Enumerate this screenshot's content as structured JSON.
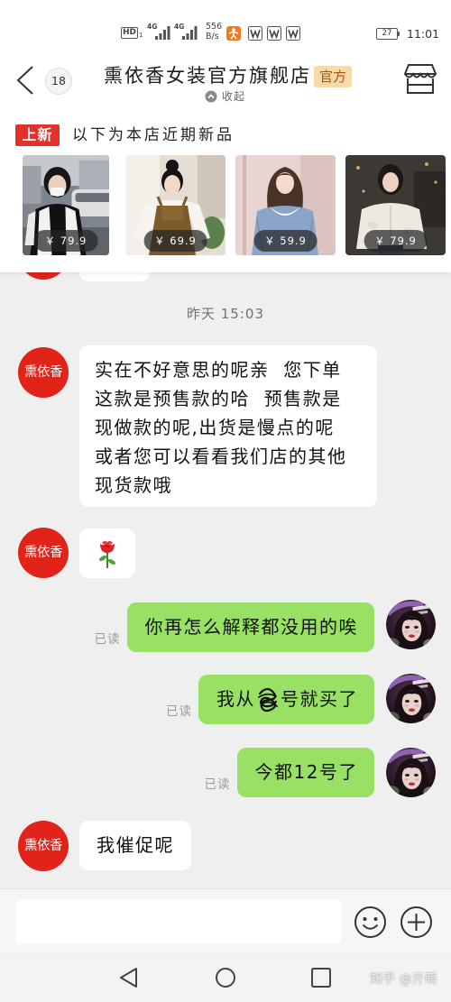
{
  "status_bar": {
    "hd_label": "HD",
    "hd_sub": "1",
    "network_1": "4G",
    "network_2": "4G",
    "speed_value": "556",
    "speed_unit": "B/s",
    "battery_level": "27",
    "time": "11:01",
    "icons": [
      "hd-icon",
      "signal-icon",
      "signal-icon",
      "app-notification-icon",
      "w-app-icon",
      "w-app-icon",
      "w-app-icon",
      "battery-icon"
    ]
  },
  "header": {
    "back_icon": "back-chevron-icon",
    "unread_count": "18",
    "title": "熏依香女装官方旗舰店",
    "official_tag": "官方",
    "collapse_icon": "chevron-up-circle-icon",
    "collapse_label": "收起",
    "store_icon": "store-icon"
  },
  "new_arrivals": {
    "tag": "上新",
    "description": "以下为本店近期新品",
    "products": [
      {
        "price": "￥ 79.9"
      },
      {
        "price": "￥ 69.9"
      },
      {
        "price": "￥ 59.9"
      },
      {
        "price": "￥ 79.9"
      }
    ]
  },
  "chat": {
    "timestamp": "昨天 15:03",
    "messages": [
      {
        "outgoing": false,
        "sender": "熏依香",
        "text": "实在不好意思的呢亲  您下单这款是预售款的哈  预售款是现做款的呢,出货是慢点的呢或者您可以看看我们店的其他现货款哦"
      },
      {
        "outgoing": false,
        "sender": "熏依香",
        "emoji": "rose-icon"
      },
      {
        "outgoing": true,
        "status": "已读",
        "text": "你再怎么解释都没用的唉"
      },
      {
        "outgoing": true,
        "status": "已读",
        "text_before": "我从",
        "text_after": "号就买了",
        "redacted": true
      },
      {
        "outgoing": true,
        "status": "已读",
        "text": "今都12号了"
      },
      {
        "outgoing": false,
        "sender": "熏依香",
        "text": "我催促呢"
      }
    ]
  },
  "input_bar": {
    "value": "",
    "emoji_icon": "smiley-icon",
    "plus_icon": "plus-circle-icon"
  },
  "nav_bar": {
    "back_icon": "triangle-back-icon",
    "home_icon": "circle-home-icon",
    "recents_icon": "square-recents-icon"
  },
  "watermark": "知乎 @亓萌",
  "colors": {
    "shop_avatar": "#e2231a",
    "new_tag": "#e4302a",
    "outgoing_bubble": "#98e165",
    "incoming_bubble": "#ffffff",
    "chat_background": "#efefef",
    "official_tag_bg": "#f9d9a6"
  }
}
